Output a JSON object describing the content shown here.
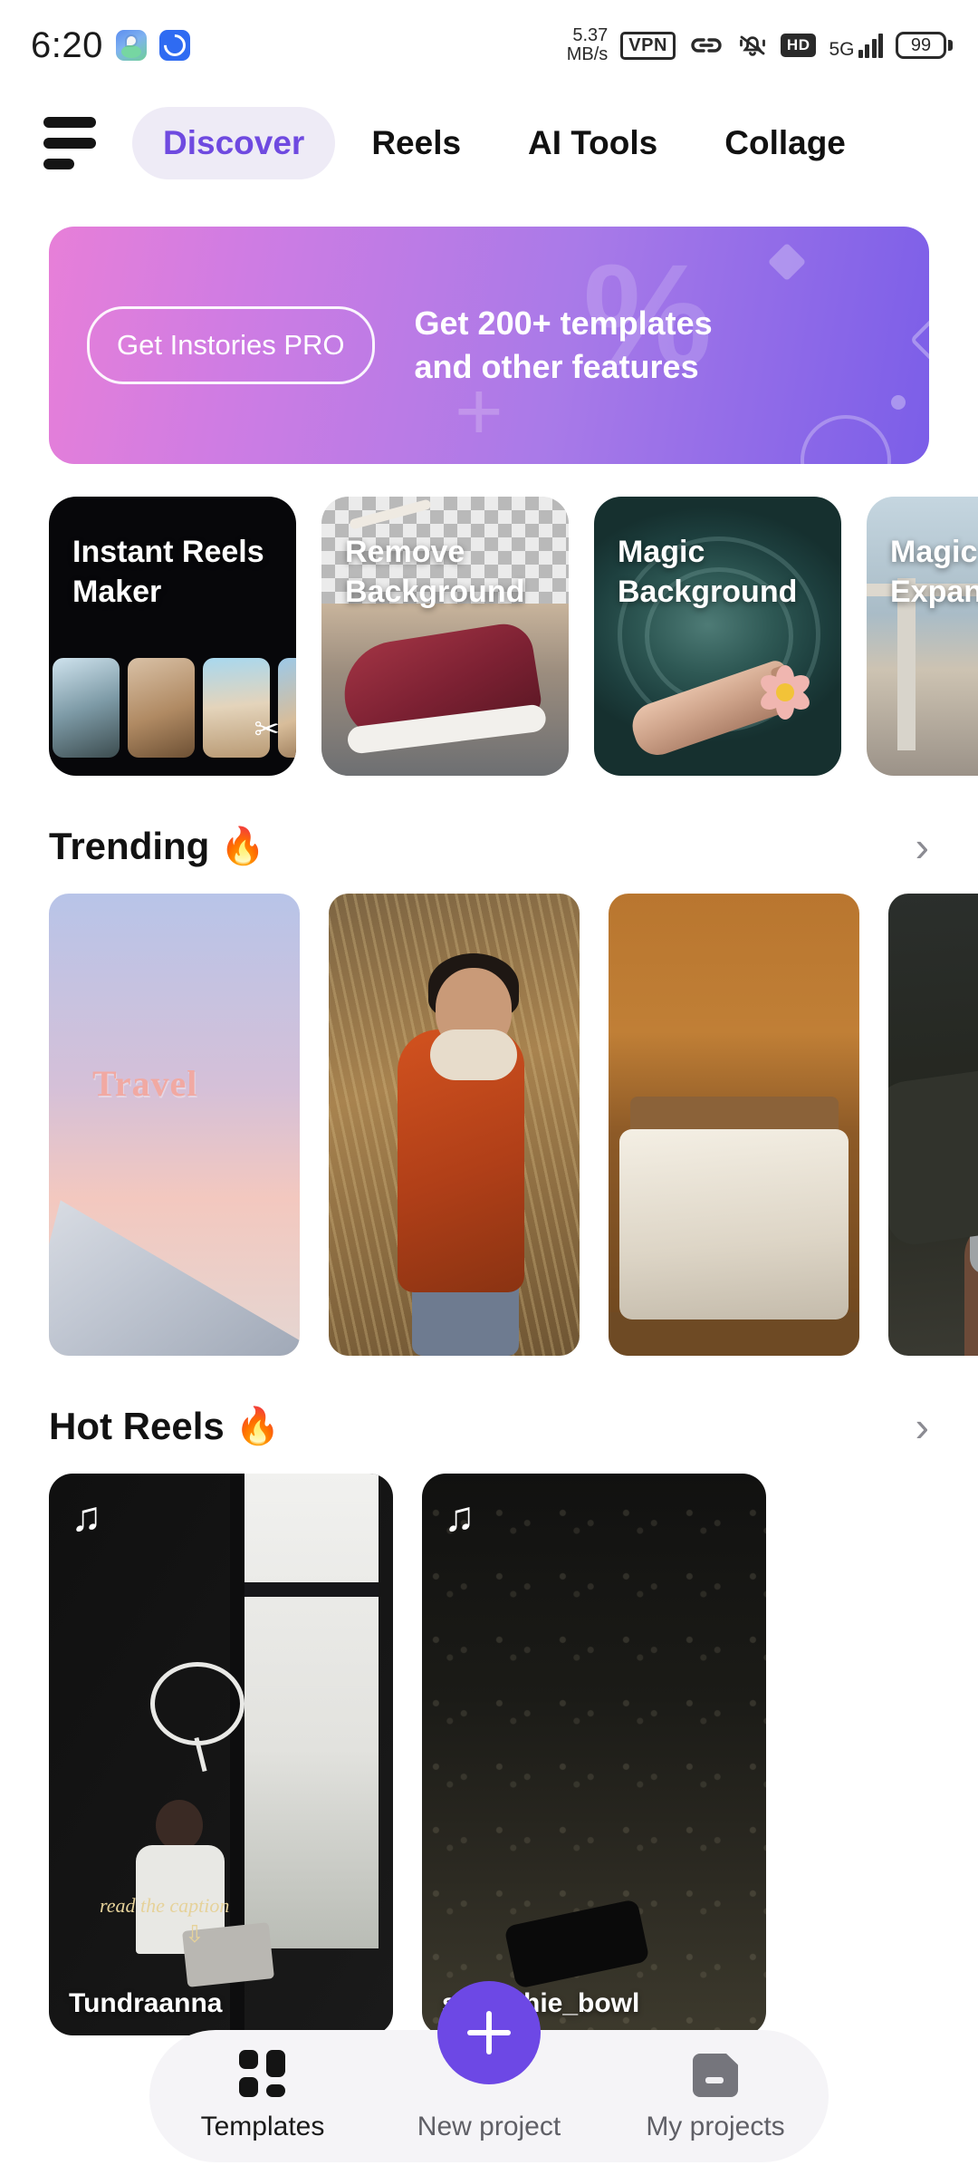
{
  "status_bar": {
    "time": "6:20",
    "net_speed_value": "5.37",
    "net_speed_unit": "MB/s",
    "vpn": "VPN",
    "hd": "HD",
    "network": "5G",
    "battery": "99",
    "icons": [
      "maps-app-icon",
      "link-app-icon",
      "vpn-badge",
      "link-icon",
      "mute-bell-icon",
      "hd-badge",
      "signal-icon",
      "battery-icon"
    ]
  },
  "topbar": {
    "menu_icon": "hamburger-menu-icon",
    "tabs": [
      {
        "label": "Discover",
        "active": true
      },
      {
        "label": "Reels",
        "active": false
      },
      {
        "label": "AI Tools",
        "active": false
      },
      {
        "label": "Collage",
        "active": false
      }
    ]
  },
  "banner": {
    "cta_label": "Get Instories PRO",
    "headline_line1": "Get 200+ templates",
    "headline_line2": "and other features",
    "gradient_start": "#e77fd8",
    "gradient_end": "#7b5ee8"
  },
  "feature_cards": [
    {
      "title_line1": "Instant Reels",
      "title_line2": "Maker"
    },
    {
      "title_line1": "Remove",
      "title_line2": "Background"
    },
    {
      "title_line1": "Magic",
      "title_line2": "Background"
    },
    {
      "title_line1": "Magic",
      "title_line2": "Expand"
    }
  ],
  "trending": {
    "title": "Trending",
    "emoji": "🔥",
    "chevron": "›",
    "cards": [
      {
        "overlay_text": "Travel"
      },
      {
        "overlay_text": ""
      },
      {
        "overlay_text": ""
      },
      {
        "overlay_text": ""
      }
    ]
  },
  "hot_reels": {
    "title": "Hot Reels",
    "emoji": "🔥",
    "chevron": "›",
    "music_icon": "♫",
    "cards": [
      {
        "username": "Tundraanna",
        "caption": "read the caption",
        "arrow": "⇩"
      },
      {
        "username": "smoothie_bowl",
        "caption": "",
        "arrow": ""
      }
    ]
  },
  "bottom_nav": {
    "accent_color": "#6d48e5",
    "items": [
      {
        "label": "Templates",
        "icon": "grid-icon",
        "active": true
      },
      {
        "label": "New project",
        "icon": "plus-icon",
        "active": false
      },
      {
        "label": "My projects",
        "icon": "folder-icon",
        "active": false
      }
    ]
  }
}
